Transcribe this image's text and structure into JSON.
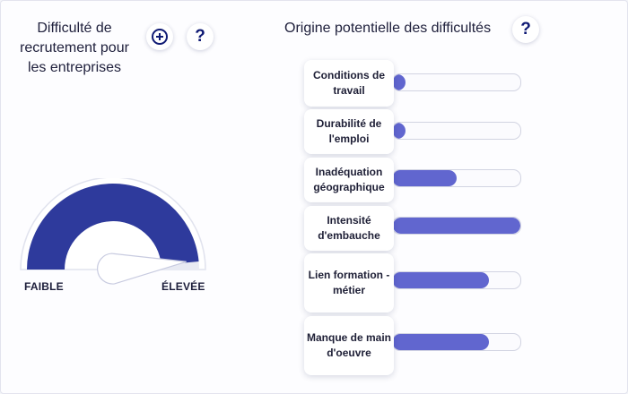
{
  "left_panel": {
    "title": "Difficulté de recrutement pour les entreprises",
    "add_icon": "plus-circle-icon",
    "help_icon": "question-icon",
    "help_label": "?",
    "gauge": {
      "label_low": "FAIBLE",
      "label_high": "ÉLEVÉE",
      "level": 0.97,
      "color": "#2e3a9c"
    }
  },
  "right_panel": {
    "title": "Origine potentielle des difficultés",
    "help_label": "?",
    "bar_color": "#6166cf",
    "factors": [
      {
        "label": "Conditions de travail",
        "value": 0.1
      },
      {
        "label": "Durabilité de l'emploi",
        "value": 0.1
      },
      {
        "label": "Inadéquation géographique",
        "value": 0.5
      },
      {
        "label": "Intensité d'embauche",
        "value": 1.0
      },
      {
        "label": "Lien formation - métier",
        "value": 0.75
      },
      {
        "label": "Manque de main d'oeuvre",
        "value": 0.75
      }
    ]
  }
}
